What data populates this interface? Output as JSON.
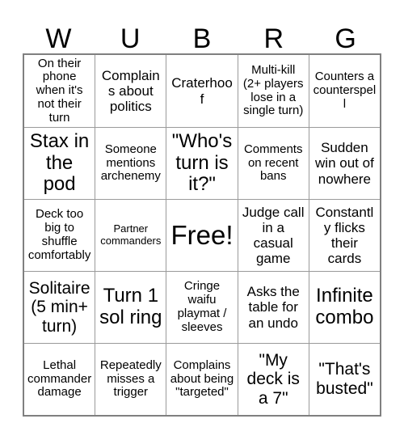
{
  "card": {
    "headers": [
      "W",
      "U",
      "B",
      "R",
      "G"
    ],
    "rows": [
      [
        {
          "text": "On their phone when it's not their turn",
          "size": "t-sm"
        },
        {
          "text": "Complains about politics",
          "size": "t-md"
        },
        {
          "text": "Craterhoof",
          "size": "t-md"
        },
        {
          "text": "Multi-kill (2+ players lose in a single turn)",
          "size": "t-sm"
        },
        {
          "text": "Counters a counterspell",
          "size": "t-sm"
        }
      ],
      [
        {
          "text": "Stax in the pod",
          "size": "t-xl"
        },
        {
          "text": "Someone mentions archenemy",
          "size": "t-sm"
        },
        {
          "text": "\"Who's turn is it?\"",
          "size": "t-xl"
        },
        {
          "text": "Comments on recent bans",
          "size": "t-sm"
        },
        {
          "text": "Sudden win out of nowhere",
          "size": "t-md"
        }
      ],
      [
        {
          "text": "Deck too big to shuffle comfortably",
          "size": "t-sm"
        },
        {
          "text": "Partner commanders",
          "size": "t-xs"
        },
        {
          "text": "Free!",
          "size": "t-free"
        },
        {
          "text": "Judge call in a casual game",
          "size": "t-md"
        },
        {
          "text": "Constantly flicks their cards",
          "size": "t-md"
        }
      ],
      [
        {
          "text": "Solitaire (5 min+ turn)",
          "size": "t-lg"
        },
        {
          "text": "Turn 1 sol ring",
          "size": "t-xl"
        },
        {
          "text": "Cringe waifu playmat / sleeves",
          "size": "t-sm"
        },
        {
          "text": "Asks the table for an undo",
          "size": "t-md"
        },
        {
          "text": "Infinite combo",
          "size": "t-xl"
        }
      ],
      [
        {
          "text": "Lethal commander damage",
          "size": "t-sm"
        },
        {
          "text": "Repeatedly misses a trigger",
          "size": "t-sm"
        },
        {
          "text": "Complains about being \"targeted\"",
          "size": "t-sm"
        },
        {
          "text": "\"My deck is a 7\"",
          "size": "t-lg"
        },
        {
          "text": "\"That's busted\"",
          "size": "t-lg"
        }
      ]
    ]
  }
}
